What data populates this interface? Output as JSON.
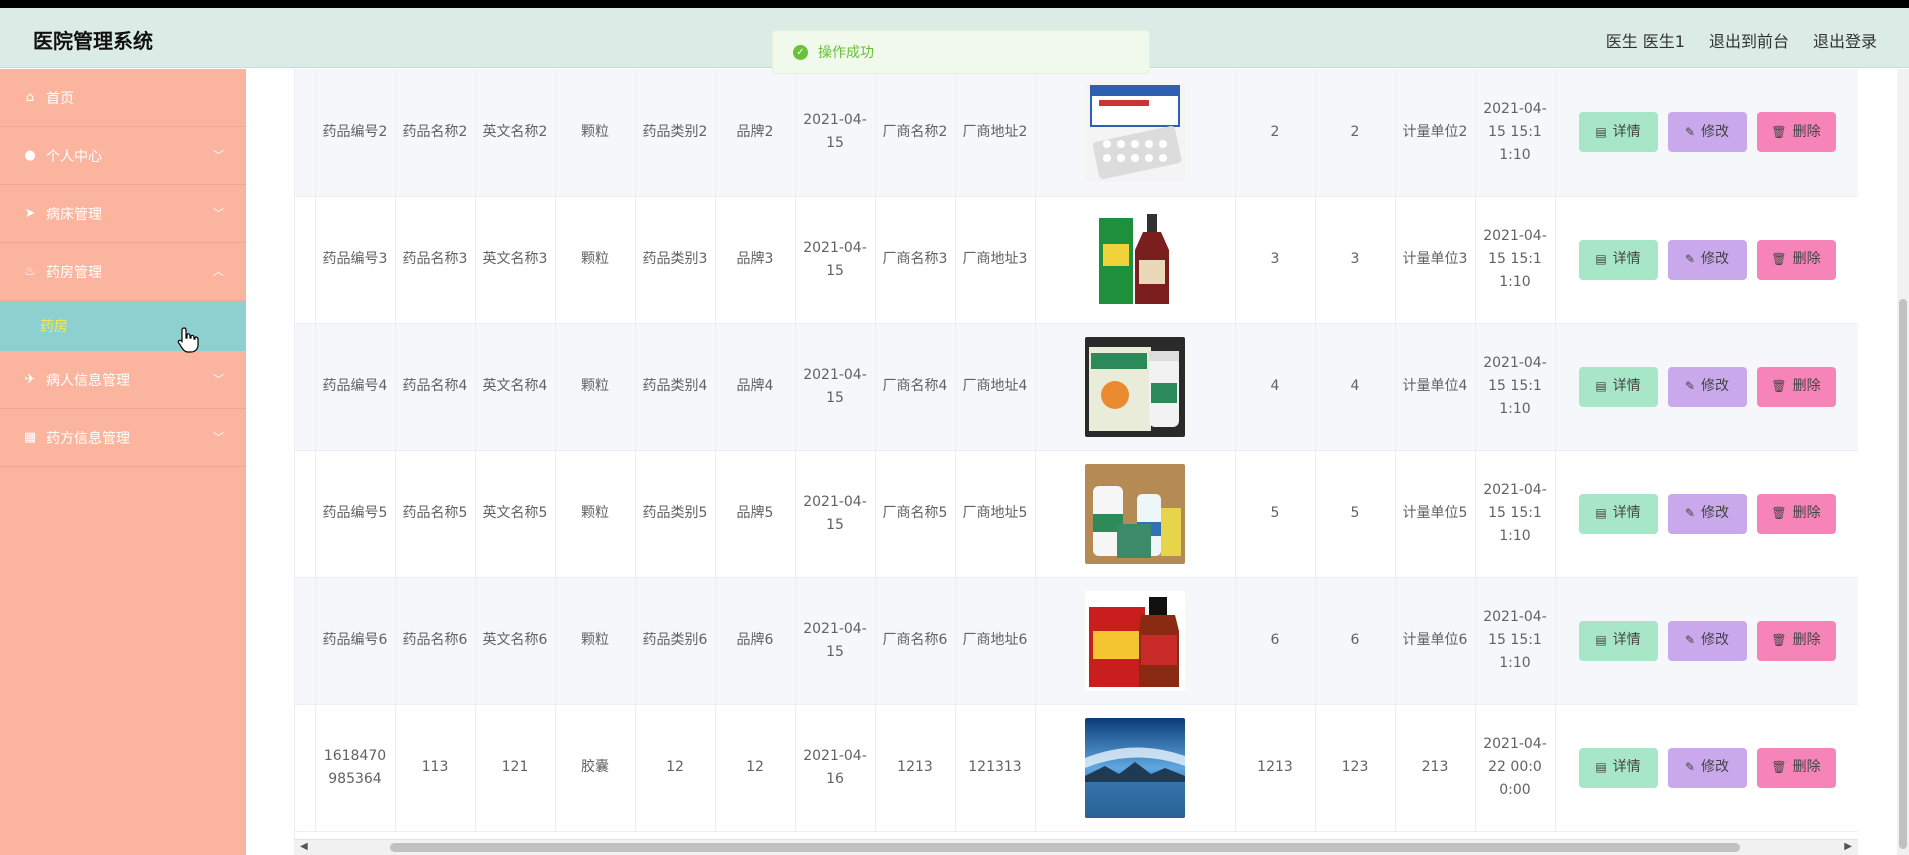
{
  "header": {
    "title": "医院管理系统",
    "user": "医生 医生1",
    "to_front": "退出到前台",
    "logout": "退出登录"
  },
  "toast": {
    "message": "操作成功"
  },
  "sidebar": {
    "items": [
      {
        "label": "首页",
        "icon": "home-icon"
      },
      {
        "label": "个人中心",
        "icon": "user-icon"
      },
      {
        "label": "病床管理",
        "icon": "send-icon"
      },
      {
        "label": "药房管理",
        "icon": "mic-icon"
      },
      {
        "label": "病人信息管理",
        "icon": "plane-icon"
      },
      {
        "label": "药方信息管理",
        "icon": "grid-icon"
      }
    ],
    "submenu": {
      "label": "药房"
    }
  },
  "actions": {
    "detail": "详情",
    "edit": "修改",
    "delete": "删除"
  },
  "rows": [
    {
      "code": "药品编号2",
      "name": "药品名称2",
      "en": "英文名称2",
      "form": "颗粒",
      "cat": "药品类别2",
      "brand": "品牌2",
      "date": "2021-04-15",
      "mfr": "厂商名称2",
      "addr": "厂商地址2",
      "a": "2",
      "b": "2",
      "unit": "计量单位2",
      "time": "2021-04-15 15:11:10"
    },
    {
      "code": "药品编号3",
      "name": "药品名称3",
      "en": "英文名称3",
      "form": "颗粒",
      "cat": "药品类别3",
      "brand": "品牌3",
      "date": "2021-04-15",
      "mfr": "厂商名称3",
      "addr": "厂商地址3",
      "a": "3",
      "b": "3",
      "unit": "计量单位3",
      "time": "2021-04-15 15:11:10"
    },
    {
      "code": "药品编号4",
      "name": "药品名称4",
      "en": "英文名称4",
      "form": "颗粒",
      "cat": "药品类别4",
      "brand": "品牌4",
      "date": "2021-04-15",
      "mfr": "厂商名称4",
      "addr": "厂商地址4",
      "a": "4",
      "b": "4",
      "unit": "计量单位4",
      "time": "2021-04-15 15:11:10"
    },
    {
      "code": "药品编号5",
      "name": "药品名称5",
      "en": "英文名称5",
      "form": "颗粒",
      "cat": "药品类别5",
      "brand": "品牌5",
      "date": "2021-04-15",
      "mfr": "厂商名称5",
      "addr": "厂商地址5",
      "a": "5",
      "b": "5",
      "unit": "计量单位5",
      "time": "2021-04-15 15:11:10"
    },
    {
      "code": "药品编号6",
      "name": "药品名称6",
      "en": "英文名称6",
      "form": "颗粒",
      "cat": "药品类别6",
      "brand": "品牌6",
      "date": "2021-04-15",
      "mfr": "厂商名称6",
      "addr": "厂商地址6",
      "a": "6",
      "b": "6",
      "unit": "计量单位6",
      "time": "2021-04-15 15:11:10"
    },
    {
      "code": "1618470985364",
      "name": "113",
      "en": "121",
      "form": "胶囊",
      "cat": "12",
      "brand": "12",
      "date": "2021-04-16",
      "mfr": "1213",
      "addr": "121313",
      "a": "1213",
      "b": "123",
      "unit": "213",
      "time": "2021-04-22 00:00:00"
    }
  ],
  "colors": {
    "header": "#dbece6",
    "sidebar": "#fbb59e",
    "submenu": "#8ecfcf",
    "detail": "#a7e6c6",
    "edit": "#c9a9ec",
    "delete": "#f684b8"
  }
}
